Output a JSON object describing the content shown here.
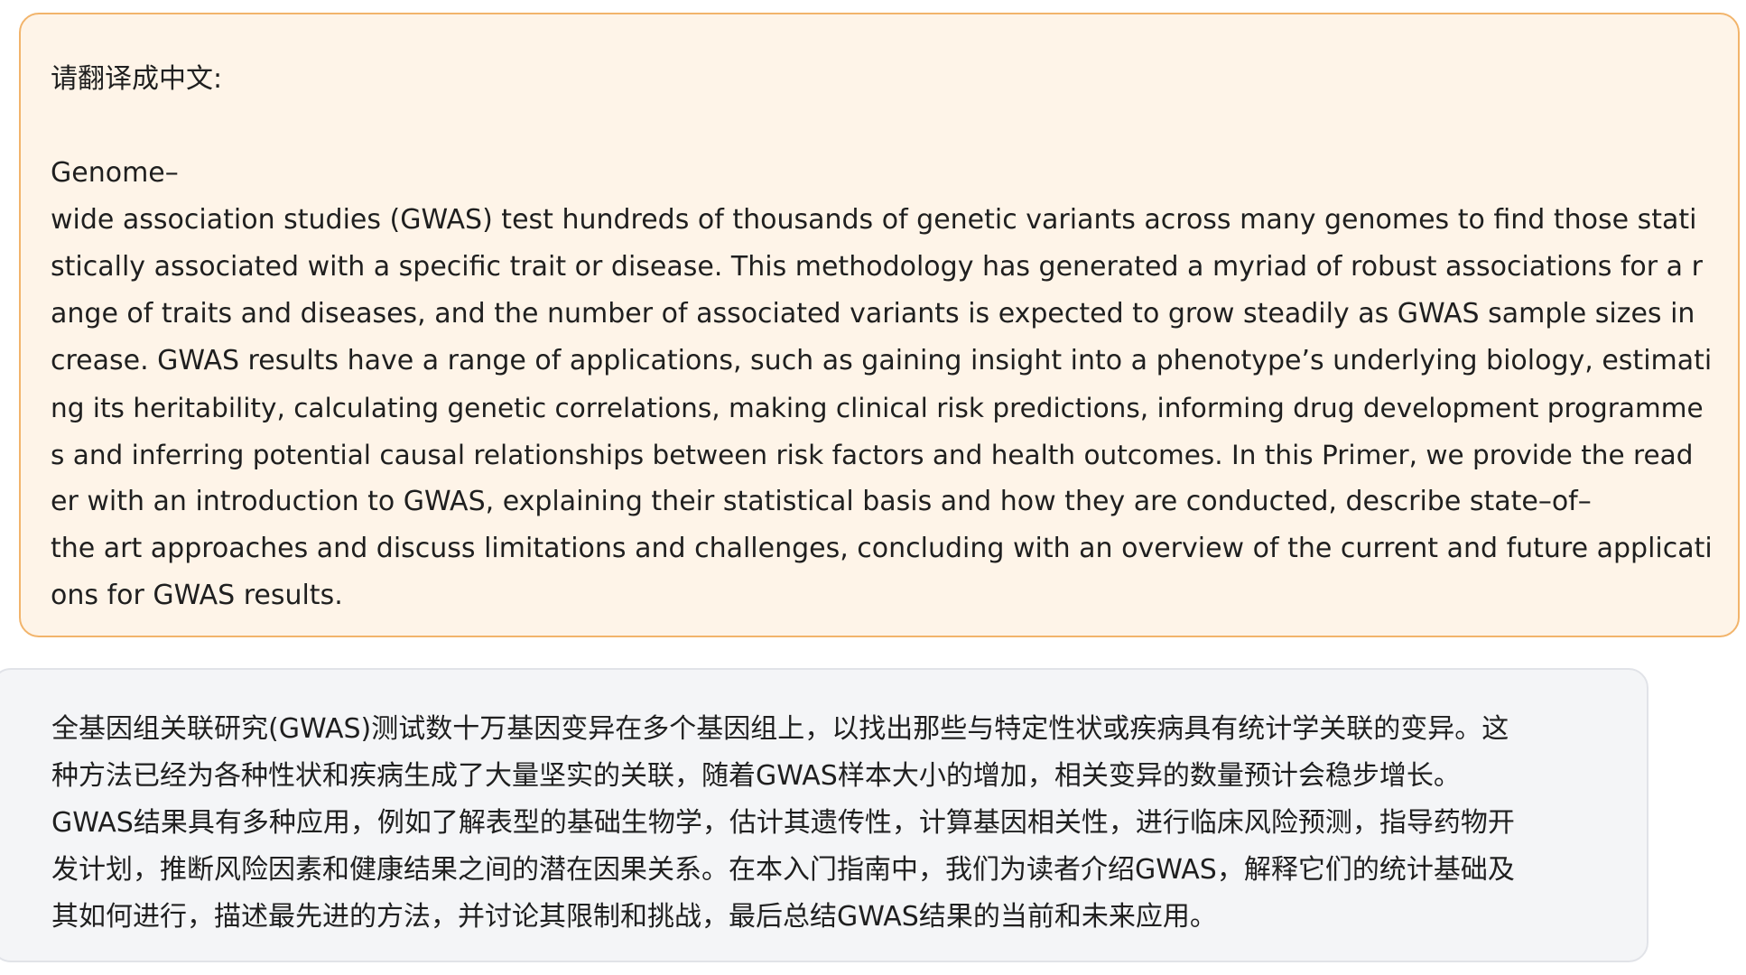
{
  "user_message": {
    "prompt": "请翻译成中文:",
    "lines": [
      "Genome–",
      "wide association studies (GWAS) test hundreds of thousands of genetic variants across many genomes to find those stati",
      "stically associated with a specific trait or disease. This methodology has generated a myriad of robust associations for a r",
      "ange of traits and diseases, and the number of associated variants is expected to grow steadily as GWAS sample sizes in",
      "crease. GWAS results have a range of applications, such as gaining insight into a phenotype’s underlying biology, estimati",
      "ng its heritability, calculating genetic correlations, making clinical risk predictions, informing drug development programme",
      "s and inferring potential causal relationships between risk factors and health outcomes. In this Primer, we provide the read",
      "er with an introduction to GWAS, explaining their statistical basis and how they are conducted, describe state–of–",
      "the art approaches and discuss limitations and challenges, concluding with an overview of the current and future applicati",
      "ons for GWAS results."
    ]
  },
  "assistant_message": {
    "lines": [
      "全基因组关联研究(GWAS)测试数十万基因变异在多个基因组上，以找出那些与特定性状或疾病具有统计学关联的变异。这",
      "种方法已经为各种性状和疾病生成了大量坚实的关联，随着GWAS样本大小的增加，相关变异的数量预计会稳步增长。",
      "GWAS结果具有多种应用，例如了解表型的基础生物学，估计其遗传性，计算基因相关性，进行临床风险预测，指导药物开",
      "发计划，推断风险因素和健康结果之间的潜在因果关系。在本入门指南中，我们为读者介绍GWAS，解释它们的统计基础及",
      "其如何进行，描述最先进的方法，并讨论其限制和挑战，最后总结GWAS结果的当前和未来应用。"
    ]
  },
  "colors": {
    "user_bubble_bg": "#fef4e8",
    "user_bubble_border": "#f2b46b",
    "assistant_bubble_bg": "#f4f5f7",
    "assistant_bubble_border": "#e1e3e8"
  }
}
